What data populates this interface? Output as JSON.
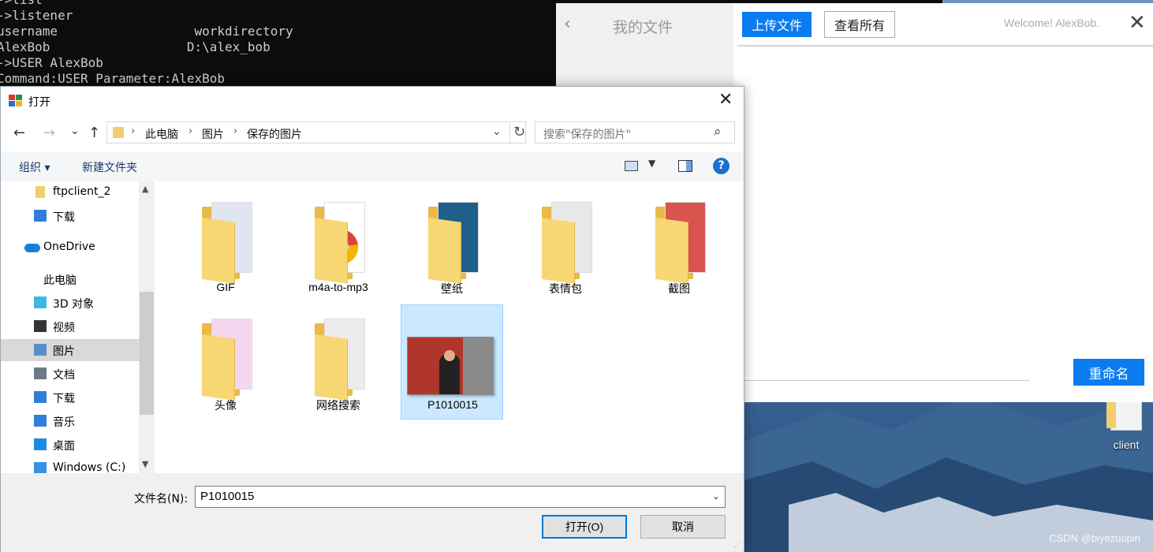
{
  "console": {
    "lines": [
      "->list",
      "->listener",
      "username                  workdirectory",
      "AlexBob                  D:\\alex_bob",
      "->USER AlexBob",
      "Command:USER Parameter:AlexBob"
    ]
  },
  "ftp_app": {
    "back_icon": "‹",
    "title": "我的文件",
    "upload_button": "上传文件",
    "view_all_button": "查看所有",
    "welcome": "Welcome! AlexBob.",
    "close_icon": "✕",
    "rename_button": "重命名"
  },
  "desktop": {
    "icon_label": "client",
    "watermark": "CSDN @biyezuopin"
  },
  "dialog": {
    "title": "打开",
    "close_icon": "✕",
    "nav": {
      "back": "←",
      "forward": "→",
      "recent": "⌄",
      "up": "↑"
    },
    "breadcrumb": [
      "此电脑",
      "图片",
      "保存的图片"
    ],
    "breadcrumb_sep": "›",
    "search_placeholder": "搜索\"保存的图片\"",
    "toolbar": {
      "organize": "组织 ▾",
      "new_folder": "新建文件夹",
      "help": "?"
    },
    "tree": [
      {
        "label": "ftpclient_2",
        "icon": "folder-icon",
        "color": "#f2cd6d"
      },
      {
        "label": "下载",
        "icon": "download-icon",
        "color": "#2f7fd8"
      },
      {
        "label": "OneDrive",
        "icon": "onedrive-icon",
        "color": "#1a7fd6"
      },
      {
        "label": "此电脑",
        "icon": "computer-icon",
        "color": "#ffffff"
      },
      {
        "label": "3D 对象",
        "icon": "3d-objects-icon",
        "color": "#3fb7e6"
      },
      {
        "label": "视频",
        "icon": "video-icon",
        "color": "#333333"
      },
      {
        "label": "图片",
        "icon": "pictures-icon",
        "color": "#5b8fc9",
        "selected": true
      },
      {
        "label": "文档",
        "icon": "documents-icon",
        "color": "#6c7a89"
      },
      {
        "label": "下载",
        "icon": "download-icon",
        "color": "#2f7fd8"
      },
      {
        "label": "音乐",
        "icon": "music-icon",
        "color": "#2f7fd8"
      },
      {
        "label": "桌面",
        "icon": "desktop-icon",
        "color": "#1e88e5"
      },
      {
        "label": "Windows (C:)",
        "icon": "drive-icon",
        "color": "#3a8ee6"
      }
    ],
    "files": [
      {
        "name": "GIF",
        "type": "folder",
        "page_color": "#dfe6ef"
      },
      {
        "name": "m4a-to-mp3",
        "type": "folder",
        "page_color": "#ffffff",
        "chrome": true
      },
      {
        "name": "壁纸",
        "type": "folder",
        "page_color": "#1f5f8a"
      },
      {
        "name": "表情包",
        "type": "folder",
        "page_color": "#e8e8e8"
      },
      {
        "name": "截图",
        "type": "folder",
        "page_color": "#d9534f"
      },
      {
        "name": "头像",
        "type": "folder",
        "page_color": "#f4d7ef"
      },
      {
        "name": "网络搜索",
        "type": "folder",
        "page_color": "#ececec"
      },
      {
        "name": "P1010015",
        "type": "image",
        "selected": true
      }
    ],
    "filename_label": "文件名(N):",
    "filename_value": "P1010015",
    "open_button": "打开(O)",
    "cancel_button": "取消"
  }
}
